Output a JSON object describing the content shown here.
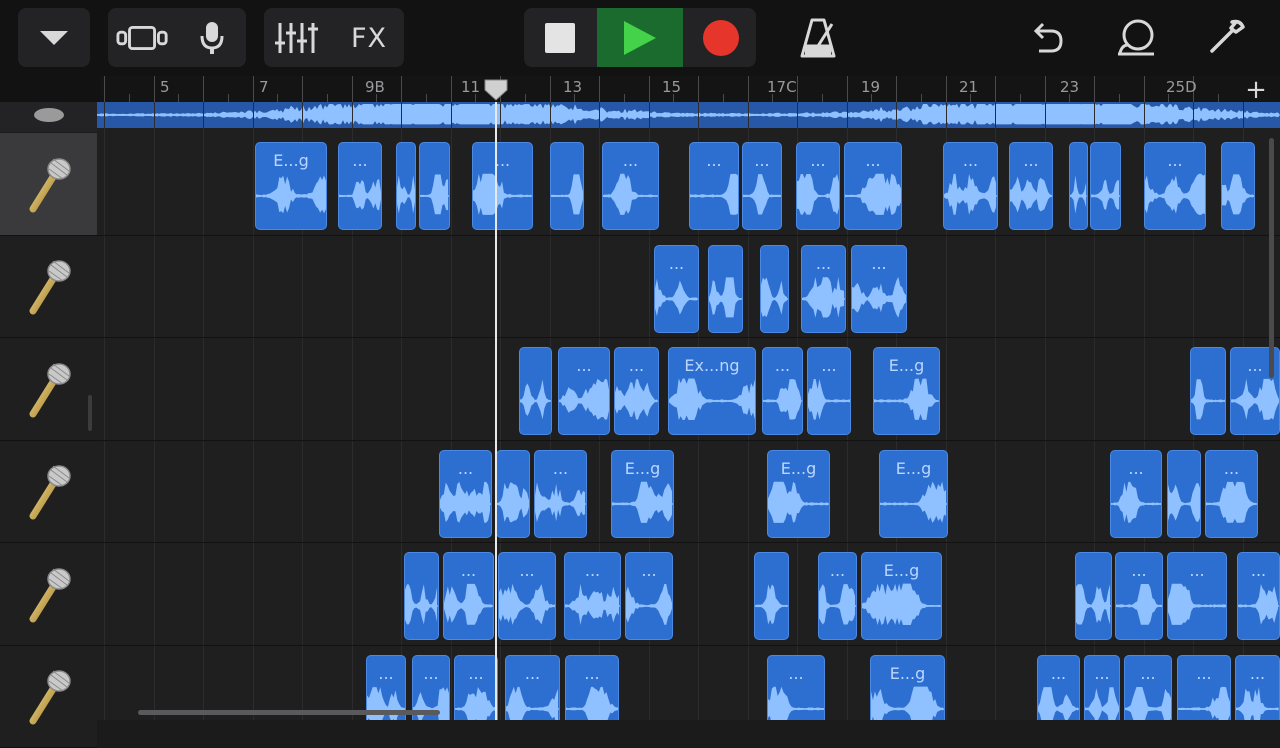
{
  "toolbar": {
    "fx_label": "FX",
    "accent_green": "#1a6b2d",
    "record_color": "#e6362b"
  },
  "ruler": {
    "bar_labels": [
      "5",
      "7",
      "9B",
      "11",
      "13",
      "15",
      "17C",
      "19",
      "21",
      "23",
      "25D"
    ],
    "add_label": "+"
  },
  "tracks": [
    {
      "name": "track-1",
      "instrument": "microphone-icon",
      "regions": [
        {
          "label": "E...g"
        },
        {
          "label": "..."
        },
        {
          "label": ""
        },
        {
          "label": ""
        },
        {
          "label": "..."
        },
        {
          "label": ""
        },
        {
          "label": "..."
        },
        {
          "label": "..."
        },
        {
          "label": "..."
        },
        {
          "label": "..."
        },
        {
          "label": "..."
        },
        {
          "label": "..."
        },
        {
          "label": "..."
        },
        {
          "label": ""
        },
        {
          "label": ""
        },
        {
          "label": "..."
        },
        {
          "label": ""
        }
      ]
    },
    {
      "name": "track-2",
      "instrument": "microphone-icon",
      "regions": [
        {
          "label": "..."
        },
        {
          "label": ""
        },
        {
          "label": ""
        },
        {
          "label": "..."
        },
        {
          "label": "..."
        }
      ]
    },
    {
      "name": "track-3",
      "instrument": "microphone-icon",
      "regions": [
        {
          "label": ""
        },
        {
          "label": "..."
        },
        {
          "label": "..."
        },
        {
          "label": "Ex...ng"
        },
        {
          "label": "..."
        },
        {
          "label": "..."
        },
        {
          "label": "E...g"
        },
        {
          "label": ""
        },
        {
          "label": "..."
        }
      ]
    },
    {
      "name": "track-4",
      "instrument": "microphone-icon",
      "regions": [
        {
          "label": "..."
        },
        {
          "label": ""
        },
        {
          "label": "..."
        },
        {
          "label": "E...g"
        },
        {
          "label": "E...g"
        },
        {
          "label": "E...g"
        },
        {
          "label": "..."
        },
        {
          "label": ""
        },
        {
          "label": "..."
        }
      ]
    },
    {
      "name": "track-5",
      "instrument": "microphone-icon",
      "regions": [
        {
          "label": ""
        },
        {
          "label": "..."
        },
        {
          "label": "..."
        },
        {
          "label": "..."
        },
        {
          "label": "..."
        },
        {
          "label": ""
        },
        {
          "label": "..."
        },
        {
          "label": "E...g"
        },
        {
          "label": ""
        },
        {
          "label": "..."
        },
        {
          "label": "..."
        },
        {
          "label": "..."
        }
      ]
    },
    {
      "name": "track-6",
      "instrument": "microphone-icon",
      "regions": [
        {
          "label": "..."
        },
        {
          "label": "..."
        },
        {
          "label": "..."
        },
        {
          "label": "..."
        },
        {
          "label": "..."
        },
        {
          "label": "..."
        },
        {
          "label": "E...g"
        },
        {
          "label": "..."
        },
        {
          "label": "..."
        },
        {
          "label": "..."
        },
        {
          "label": "..."
        },
        {
          "label": "..."
        }
      ]
    }
  ]
}
